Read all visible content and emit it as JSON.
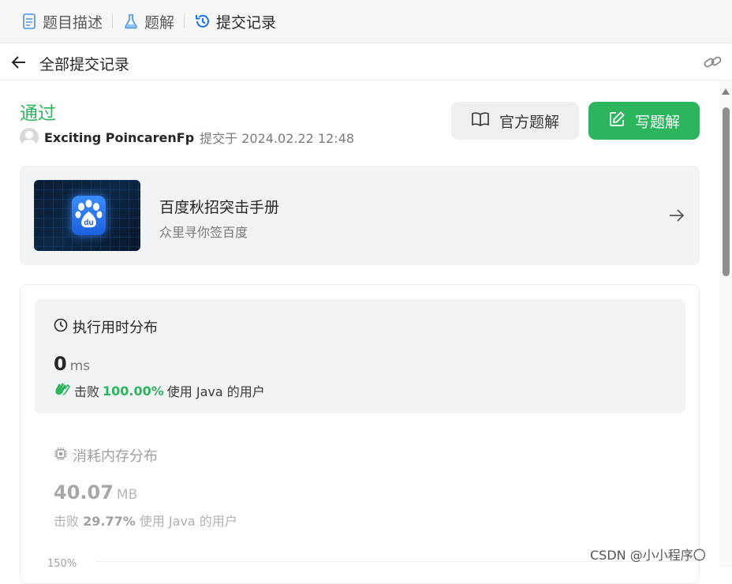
{
  "tabs": [
    {
      "label": "题目描述",
      "icon": "document-icon",
      "active": false
    },
    {
      "label": "题解",
      "icon": "flask-icon",
      "active": false
    },
    {
      "label": "提交记录",
      "icon": "history-icon",
      "active": true
    }
  ],
  "header": {
    "title": "全部提交记录"
  },
  "submission": {
    "status": "通过",
    "author": "Exciting PoincarenFp",
    "submitted_text": "提交于 2024.02.22 12:48"
  },
  "buttons": {
    "official": "官方题解",
    "write": "写题解"
  },
  "promo": {
    "title": "百度秋招突击手册",
    "subtitle": "众里寻你签百度"
  },
  "runtime": {
    "title": "执行用时分布",
    "value": "0",
    "unit": "ms",
    "beat_prefix": "击败",
    "beat_percent": "100.00%",
    "beat_suffix": "使用 Java 的用户"
  },
  "memory": {
    "title": "消耗内存分布",
    "value": "40.07",
    "unit": "MB",
    "beat_prefix": "击败",
    "beat_percent": "29.77%",
    "beat_suffix": "使用 Java 的用户"
  },
  "chart": {
    "y_tick": "150%"
  },
  "watermark": "CSDN @小小程序〇",
  "colors": {
    "accent": "#2db55d",
    "link": "#1a73e8"
  }
}
